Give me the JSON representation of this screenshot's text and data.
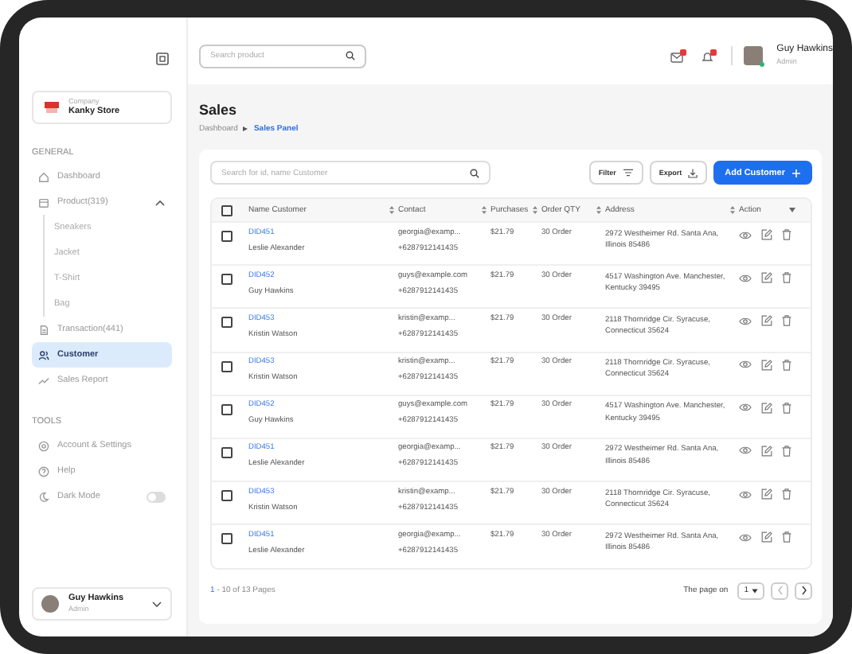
{
  "sidebar": {
    "company": {
      "label": "Company",
      "name": "Kanky Store"
    },
    "sections": [
      {
        "title": "GENERAL",
        "items": [
          {
            "label": "Dashboard",
            "selected": false
          },
          {
            "label": "Product(319)",
            "selected": false,
            "expanded": true,
            "children": [
              {
                "label": "Sneakers"
              },
              {
                "label": "Jacket"
              },
              {
                "label": "T-Shirt"
              },
              {
                "label": "Bag"
              }
            ]
          },
          {
            "label": "Transaction(441)",
            "selected": false
          },
          {
            "label": "Customer",
            "selected": true
          },
          {
            "label": "Sales Report",
            "selected": false
          }
        ]
      },
      {
        "title": "TOOLS",
        "items": [
          {
            "label": "Account & Settings",
            "selected": false
          },
          {
            "label": "Help",
            "selected": false
          },
          {
            "label": "Dark Mode",
            "selected": false,
            "kind": "toggle",
            "on": false
          }
        ]
      }
    ],
    "user": {
      "name": "Guy Hawkins",
      "role": "Admin"
    }
  },
  "topbar": {
    "search": {
      "placeholder": "Search product"
    },
    "user": {
      "name": "Guy Hawkins",
      "role": "Admin"
    }
  },
  "page": {
    "title": "Sales",
    "breadcrumb": [
      {
        "label": "Dashboard",
        "selected": false
      },
      {
        "label": "Sales Panel",
        "selected": true
      }
    ]
  },
  "toolbar": {
    "search": {
      "placeholder": "Search for id, name Customer"
    },
    "buttons": [
      "Filter",
      "Export",
      "Add Customer"
    ]
  },
  "table": {
    "all_checked": false,
    "columns": [
      {
        "label": "Name Customer",
        "sortable": true
      },
      {
        "label": "Contact",
        "sortable": true
      },
      {
        "label": "Purchases",
        "sortable": true
      },
      {
        "label": "Order QTY",
        "sortable": true
      },
      {
        "label": "Address",
        "sortable": true
      },
      {
        "label": "Action",
        "sortable": false
      }
    ],
    "rows": [
      {
        "checked": false,
        "id": "DID451",
        "name": "Leslie Alexander",
        "email": "georgia@examp...",
        "phone": "+6287912141435",
        "purchases": "$21.79",
        "orders": "30 Order",
        "address": "2972 Westheimer Rd. Santa Ana, Illinois 85486"
      },
      {
        "checked": false,
        "id": "DID452",
        "name": "Guy Hawkins",
        "email": "guys@example.com",
        "phone": "+6287912141435",
        "purchases": "$21.79",
        "orders": "30 Order",
        "address": "4517 Washington Ave. Manchester, Kentucky 39495"
      },
      {
        "checked": false,
        "id": "DID453",
        "name": "Kristin Watson",
        "email": "kristin@examp...",
        "phone": "+6287912141435",
        "purchases": "$21.79",
        "orders": "30 Order",
        "address": "2118 Thornridge Cir. Syracuse, Connecticut 35624"
      },
      {
        "checked": false,
        "id": "DID453",
        "name": "Kristin Watson",
        "email": "kristin@examp...",
        "phone": "+6287912141435",
        "purchases": "$21.79",
        "orders": "30 Order",
        "address": "2118 Thornridge Cir. Syracuse, Connecticut 35624"
      },
      {
        "checked": false,
        "id": "DID452",
        "name": "Guy Hawkins",
        "email": "guys@example.com",
        "phone": "+6287912141435",
        "purchases": "$21.79",
        "orders": "30 Order",
        "address": "4517 Washington Ave. Manchester, Kentucky 39495"
      },
      {
        "checked": false,
        "id": "DID451",
        "name": "Leslie Alexander",
        "email": "georgia@examp...",
        "phone": "+6287912141435",
        "purchases": "$21.79",
        "orders": "30 Order",
        "address": "2972 Westheimer Rd. Santa Ana, Illinois 85486"
      },
      {
        "checked": false,
        "id": "DID453",
        "name": "Kristin Watson",
        "email": "kristin@examp...",
        "phone": "+6287912141435",
        "purchases": "$21.79",
        "orders": "30 Order",
        "address": "2118 Thornridge Cir. Syracuse, Connecticut 35624"
      },
      {
        "checked": false,
        "id": "DID451",
        "name": "Leslie Alexander",
        "email": "georgia@examp...",
        "phone": "+6287912141435",
        "purchases": "$21.79",
        "orders": "30 Order",
        "address": "2972 Westheimer Rd. Santa Ana, Illinois 85486"
      }
    ]
  },
  "pagination": {
    "range_start": "1",
    "range_rest": "- 10 of 13 Pages",
    "page_label": "The page on",
    "page_value": "1"
  }
}
